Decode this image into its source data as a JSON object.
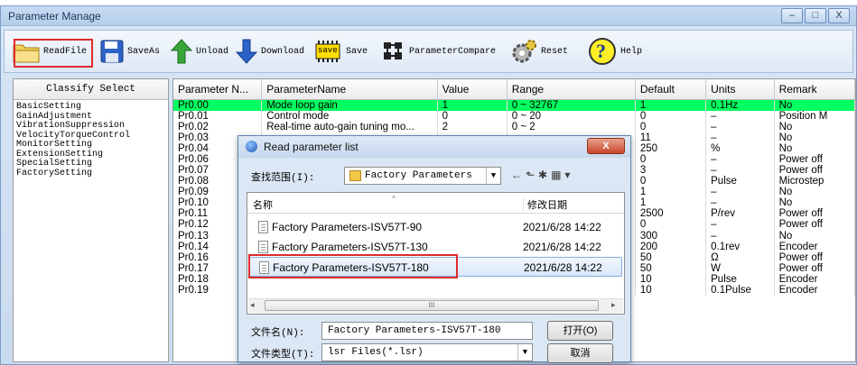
{
  "window": {
    "title": "Parameter Manage",
    "buttons": [
      "–",
      "□",
      "X"
    ]
  },
  "toolbar": [
    {
      "label": "ReadFile",
      "icon": "folder-icon"
    },
    {
      "label": "SaveAs",
      "icon": "floppy-disk-icon"
    },
    {
      "label": "Unload",
      "icon": "arrow-up-icon"
    },
    {
      "label": "Download",
      "icon": "arrow-down-icon"
    },
    {
      "label": "Save",
      "icon": "chip-save-icon",
      "badge": "save"
    },
    {
      "label": "ParameterCompare",
      "icon": "compare-icon"
    },
    {
      "label": "Reset",
      "icon": "gear-icon"
    },
    {
      "label": "Help",
      "icon": "help-icon",
      "glyph": "?"
    }
  ],
  "classify": {
    "header": "Classify Select",
    "items": [
      "BasicSetting",
      "GainAdjustment",
      "VibrationSuppression",
      "VelocityTorqueControl",
      "MonitorSetting",
      "ExtensionSetting",
      "SpecialSetting",
      "FactorySetting"
    ]
  },
  "table": {
    "columns": [
      "Parameter N...",
      "ParameterName",
      "Value",
      "Range",
      "Default",
      "Units",
      "Remark"
    ],
    "rows": [
      [
        "Pr0.00",
        "Mode loop gain",
        "1",
        "0 ~ 32767",
        "1",
        "0.1Hz",
        "No"
      ],
      [
        "Pr0.01",
        "Control mode",
        "0",
        "0 ~ 20",
        "0",
        "–",
        "Position M"
      ],
      [
        "Pr0.02",
        "Real-time auto-gain tuning mo...",
        "2",
        "0 ~ 2",
        "0",
        "–",
        "No"
      ],
      [
        "Pr0.03",
        "",
        "",
        "",
        "11",
        "–",
        "No"
      ],
      [
        "Pr0.04",
        "",
        "",
        "",
        "250",
        "%",
        "No"
      ],
      [
        "Pr0.06",
        "",
        "",
        "",
        "0",
        "–",
        "Power off"
      ],
      [
        "Pr0.07",
        "",
        "",
        "",
        "3",
        "–",
        "Power off"
      ],
      [
        "Pr0.08",
        "",
        "",
        "",
        "0",
        "Pulse",
        "Microstep"
      ],
      [
        "Pr0.09",
        "",
        "",
        "",
        "1",
        "–",
        "No"
      ],
      [
        "Pr0.10",
        "",
        "",
        "",
        "1",
        "–",
        "No"
      ],
      [
        "Pr0.11",
        "",
        "",
        "",
        "2500",
        "P/rev",
        "Power off"
      ],
      [
        "Pr0.12",
        "",
        "",
        "",
        "0",
        "–",
        "Power off"
      ],
      [
        "Pr0.13",
        "",
        "",
        "",
        "300",
        "–",
        "No"
      ],
      [
        "Pr0.14",
        "",
        "",
        "",
        "200",
        "0.1rev",
        "Encoder"
      ],
      [
        "Pr0.16",
        "",
        "",
        "",
        "50",
        "Ω",
        "Power off"
      ],
      [
        "Pr0.17",
        "",
        "",
        "",
        "50",
        "W",
        "Power off"
      ],
      [
        "Pr0.18",
        "",
        "",
        "",
        "10",
        "Pulse",
        "Encoder"
      ],
      [
        "Pr0.19",
        "",
        "",
        "",
        "10",
        "0.1Pulse",
        "Encoder"
      ]
    ],
    "selected_row": 0,
    "highlight_color": "#00ff60"
  },
  "dialog": {
    "title": "Read parameter list",
    "close": "X",
    "lookin_label": "查找范围(I):",
    "lookin_value": "Factory Parameters",
    "col_name": "名称",
    "col_date": "修改日期",
    "files": [
      {
        "name": "Factory Parameters-ISV57T-90",
        "date": "2021/6/28 14:22"
      },
      {
        "name": "Factory Parameters-ISV57T-130",
        "date": "2021/6/28 14:22"
      },
      {
        "name": "Factory Parameters-ISV57T-180",
        "date": "2021/6/28 14:22"
      }
    ],
    "selected_file": 2,
    "filename_label": "文件名(N):",
    "filename_value": "Factory Parameters-ISV57T-180",
    "filetype_label": "文件类型(T):",
    "filetype_value": "lsr Files(*.lsr)",
    "open_button": "打开(O)",
    "cancel_button": "取消",
    "scroll_thumb": "III"
  },
  "colors": {
    "highlight_red": "#e02a2a",
    "selected_row": "#00ff60"
  }
}
